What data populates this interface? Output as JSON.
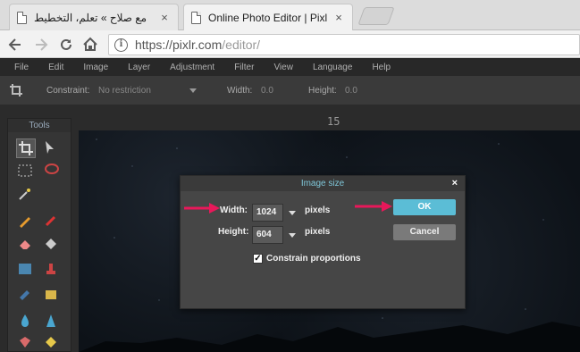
{
  "browser": {
    "tabs": [
      {
        "title": "مع صلاح » تعلم، التخطيط",
        "close": "×"
      },
      {
        "title": "Online Photo Editor | Pixl",
        "close": "×"
      }
    ],
    "url_base": "https://pixlr.com",
    "url_path": "/editor/",
    "info_glyph": "i"
  },
  "menu": {
    "items": [
      "File",
      "Edit",
      "Image",
      "Layer",
      "Adjustment",
      "Filter",
      "View",
      "Language",
      "Help"
    ]
  },
  "options": {
    "constraint_label": "Constraint:",
    "constraint_value": "No restriction",
    "width_label": "Width:",
    "width_value": "0.0",
    "height_label": "Height:",
    "height_value": "0.0"
  },
  "tools_panel": {
    "title": "Tools"
  },
  "zoom_value": "15",
  "dialog": {
    "title": "Image size",
    "close": "×",
    "width_label": "Width:",
    "width_value": "1024",
    "height_label": "Height:",
    "height_value": "604",
    "units_label": "pixels",
    "ok_label": "OK",
    "cancel_label": "Cancel",
    "constrain_label": "Constrain proportions",
    "constrain_checked": true,
    "check_glyph": "✓"
  },
  "colors": {
    "accent": "#5bbdd6",
    "annotation_arrow": "#e8185a"
  }
}
